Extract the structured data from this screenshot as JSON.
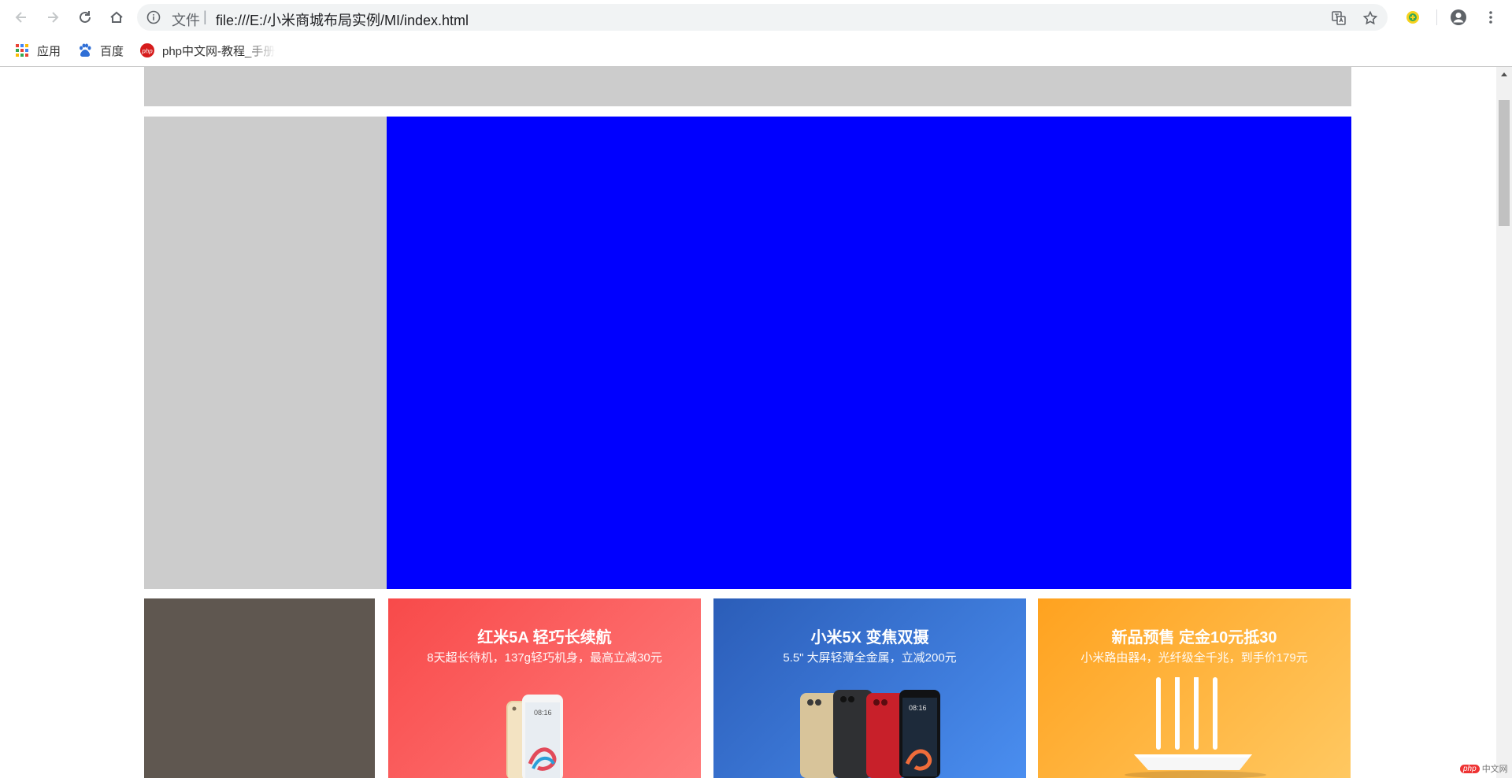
{
  "browser": {
    "url_scheme": "文件",
    "url": "file:///E:/小米商城布局实例/MI/index.html",
    "bookmarks": [
      {
        "label": "应用",
        "icon": "apps-grid-icon"
      },
      {
        "label": "百度",
        "icon": "baidu-paw-icon"
      },
      {
        "label": "php中文网-教程_手册",
        "icon": "php-logo-icon"
      }
    ]
  },
  "page": {
    "header_color": "#cccccc",
    "side_nav_color": "#cccccc",
    "banner_color": "#0000ff",
    "sub_left_color": "#5f5750",
    "promos": [
      {
        "title": "红米5A 轻巧长续航",
        "subtitle": "8天超长待机，137g轻巧机身，最高立减30元",
        "accent": "#f84a4a"
      },
      {
        "title": "小米5X 变焦双摄",
        "subtitle": "5.5\" 大屏轻薄全金属，立减200元",
        "accent": "#2b5db8"
      },
      {
        "title": "新品预售 定金10元抵30",
        "subtitle": "小米路由器4，光纤级全千兆，到手价179元",
        "accent": "#ffa21f"
      }
    ]
  },
  "watermark": {
    "logo": "php",
    "text": "中文网"
  }
}
